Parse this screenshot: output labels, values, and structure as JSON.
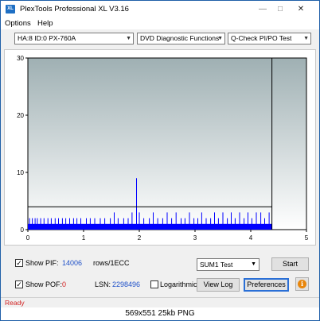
{
  "window": {
    "title": "PlexTools Professional XL V3.16",
    "icon_label": "XL"
  },
  "menu": {
    "options": "Options",
    "help": "Help"
  },
  "toolbar": {
    "drive": "HA:8 ID:0  PX-760A",
    "function": "DVD Diagnostic Functions",
    "test": "Q-Check PI/PO Test"
  },
  "chart_data": {
    "type": "bar",
    "x_ticks": [
      "0",
      "1",
      "2",
      "3",
      "4",
      "5"
    ],
    "y_ticks": [
      "0",
      "10",
      "20",
      "30"
    ],
    "xlim": [
      0,
      5
    ],
    "ylim": [
      0,
      30
    ],
    "x_end": 4.38,
    "threshold": 4,
    "baseline_height": 1,
    "spikes": [
      {
        "x": 0.03,
        "y": 2
      },
      {
        "x": 0.08,
        "y": 2
      },
      {
        "x": 0.13,
        "y": 2
      },
      {
        "x": 0.17,
        "y": 2
      },
      {
        "x": 0.23,
        "y": 2
      },
      {
        "x": 0.29,
        "y": 2
      },
      {
        "x": 0.36,
        "y": 2
      },
      {
        "x": 0.42,
        "y": 2
      },
      {
        "x": 0.49,
        "y": 2
      },
      {
        "x": 0.55,
        "y": 2
      },
      {
        "x": 0.62,
        "y": 2
      },
      {
        "x": 0.68,
        "y": 2
      },
      {
        "x": 0.75,
        "y": 2
      },
      {
        "x": 0.82,
        "y": 2
      },
      {
        "x": 0.88,
        "y": 2
      },
      {
        "x": 0.95,
        "y": 2
      },
      {
        "x": 1.05,
        "y": 2
      },
      {
        "x": 1.12,
        "y": 2
      },
      {
        "x": 1.2,
        "y": 2
      },
      {
        "x": 1.3,
        "y": 2
      },
      {
        "x": 1.38,
        "y": 2
      },
      {
        "x": 1.48,
        "y": 2
      },
      {
        "x": 1.55,
        "y": 3
      },
      {
        "x": 1.62,
        "y": 2
      },
      {
        "x": 1.72,
        "y": 2
      },
      {
        "x": 1.8,
        "y": 2
      },
      {
        "x": 1.87,
        "y": 3
      },
      {
        "x": 1.95,
        "y": 9
      },
      {
        "x": 2.0,
        "y": 3
      },
      {
        "x": 2.08,
        "y": 2
      },
      {
        "x": 2.18,
        "y": 2
      },
      {
        "x": 2.25,
        "y": 3
      },
      {
        "x": 2.33,
        "y": 2
      },
      {
        "x": 2.42,
        "y": 2
      },
      {
        "x": 2.5,
        "y": 3
      },
      {
        "x": 2.58,
        "y": 2
      },
      {
        "x": 2.66,
        "y": 3
      },
      {
        "x": 2.75,
        "y": 2
      },
      {
        "x": 2.82,
        "y": 2
      },
      {
        "x": 2.9,
        "y": 3
      },
      {
        "x": 2.98,
        "y": 2
      },
      {
        "x": 3.05,
        "y": 2
      },
      {
        "x": 3.12,
        "y": 3
      },
      {
        "x": 3.2,
        "y": 2
      },
      {
        "x": 3.28,
        "y": 2
      },
      {
        "x": 3.35,
        "y": 3
      },
      {
        "x": 3.42,
        "y": 2
      },
      {
        "x": 3.5,
        "y": 3
      },
      {
        "x": 3.58,
        "y": 2
      },
      {
        "x": 3.65,
        "y": 3
      },
      {
        "x": 3.72,
        "y": 2
      },
      {
        "x": 3.8,
        "y": 3
      },
      {
        "x": 3.88,
        "y": 2
      },
      {
        "x": 3.95,
        "y": 3
      },
      {
        "x": 4.02,
        "y": 2
      },
      {
        "x": 4.1,
        "y": 3
      },
      {
        "x": 4.18,
        "y": 3
      },
      {
        "x": 4.25,
        "y": 2
      },
      {
        "x": 4.33,
        "y": 3
      }
    ],
    "grid": false,
    "colors": {
      "bg_top": "#9fb0b3",
      "bg_bottom": "#ffffff",
      "bars": "#0000ff",
      "threshold": "#000000"
    }
  },
  "controls": {
    "show_pif_label": "Show PIF:",
    "pif_value": "14006",
    "rows_label": "rows/1ECC",
    "show_pof_label": "Show POF:",
    "pof_value": "0",
    "lsn_label": "LSN:",
    "lsn_value": "2298496",
    "logarithmic_label": "Logarithmic",
    "sum_select": "SUM1 Test",
    "start_button": "Start",
    "view_log_button": "View Log",
    "preferences_button": "Preferences",
    "show_pif_checked": true,
    "show_pof_checked": true,
    "logarithmic_checked": false
  },
  "status": {
    "text": "Ready"
  },
  "caption": {
    "text": "569x551  25kb  PNG"
  }
}
